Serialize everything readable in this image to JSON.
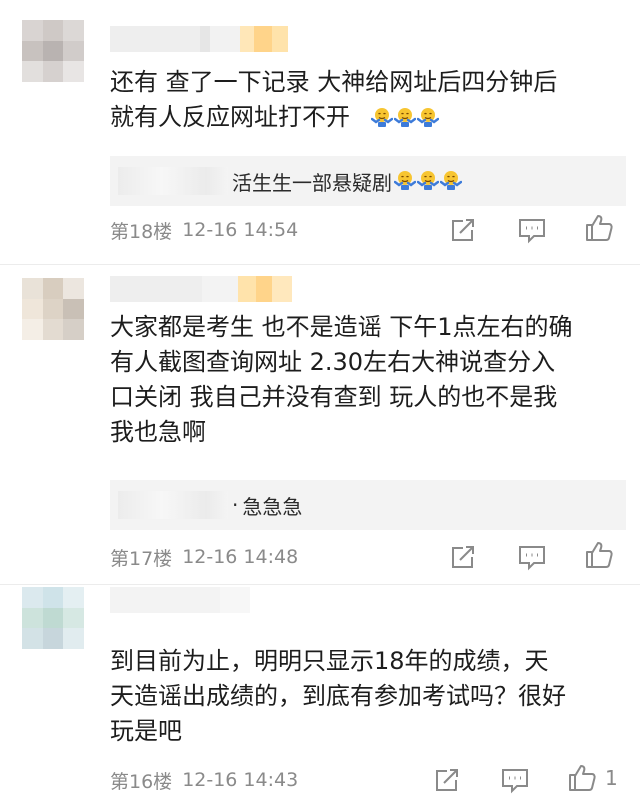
{
  "comments": [
    {
      "text_line1": "还有 查了一下记录 大神给网址后四分钟后",
      "text_line2": "就有人反应网址打不开",
      "reply_text": "活生生一部悬疑剧",
      "floor": "第18楼",
      "time": "12-16 14:54",
      "like_count": "",
      "emoji_count": 3,
      "reply_emoji_count": 3
    },
    {
      "text_line1": "大家都是考生 也不是造谣 下午1点左右的确",
      "text_line2": "有人截图查询网址 2.30左右大神说查分入",
      "text_line3": "口关闭 我自己并没有查到 玩人的也不是我",
      "text_line4": "我也急啊",
      "reply_prefix": "·",
      "reply_text": "急急急",
      "floor": "第17楼",
      "time": "12-16 14:48",
      "like_count": ""
    },
    {
      "text_line1": "到目前为止，明明只显示18年的成绩，天",
      "text_line2": "天造谣出成绩的，到底有参加考试吗？很好",
      "text_line3": "玩是吧",
      "floor": "第16楼",
      "time": "12-16 14:43",
      "like_count": "1"
    }
  ],
  "icons": {
    "share": "share-icon",
    "comment": "comment-icon",
    "like": "thumbs-up-icon",
    "emoji": "shrug-emoji"
  },
  "colors": {
    "meta_text": "#8a8a8a",
    "reply_bg": "#f3f3f3",
    "emoji_face": "#f7c531",
    "emoji_hands": "#3d7bd9"
  }
}
